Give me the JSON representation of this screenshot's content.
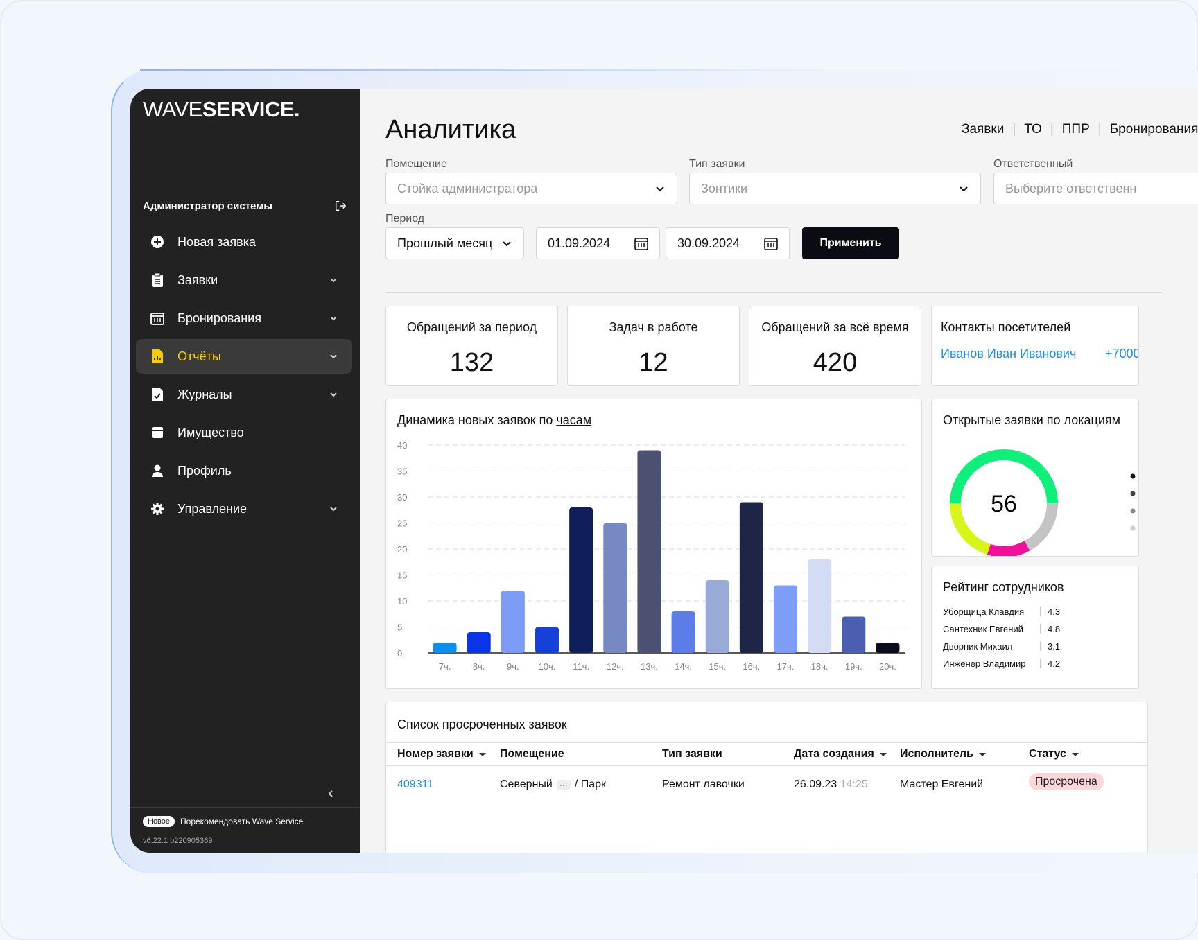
{
  "brand": {
    "logo_thin": "WAVE",
    "logo_bold": "SERVICE."
  },
  "sidebar": {
    "user_name": "Администратор системы",
    "items": [
      {
        "label": "Новая заявка",
        "icon": "plus-circle-icon",
        "has_chevron": false,
        "active": false
      },
      {
        "label": "Заявки",
        "icon": "clipboard-icon",
        "has_chevron": true,
        "active": false
      },
      {
        "label": "Бронирования",
        "icon": "calendar-icon",
        "has_chevron": true,
        "active": false
      },
      {
        "label": "Отчёты",
        "icon": "report-icon",
        "has_chevron": true,
        "active": true
      },
      {
        "label": "Журналы",
        "icon": "journal-check-icon",
        "has_chevron": true,
        "active": false
      },
      {
        "label": "Имущество",
        "icon": "archive-icon",
        "has_chevron": false,
        "active": false
      },
      {
        "label": "Профиль",
        "icon": "user-icon",
        "has_chevron": false,
        "active": false
      },
      {
        "label": "Управление",
        "icon": "gear-icon",
        "has_chevron": true,
        "active": false
      }
    ],
    "footer": {
      "badge": "Новое",
      "recommend": "Порекомендовать Wave Service",
      "version": "v6.22.1 b220905369"
    }
  },
  "page": {
    "title": "Аналитика"
  },
  "top_tabs": [
    "Заявки",
    "ТО",
    "ППР",
    "Бронирования"
  ],
  "filters": {
    "room_label": "Помещение",
    "room_placeholder": "Стойка администратора",
    "type_label": "Тип заявки",
    "type_placeholder": "Зонтики",
    "resp_label": "Ответственный",
    "resp_placeholder": "Выберите ответственн",
    "period_label": "Период",
    "period_value": "Прошлый месяц",
    "date_from": "01.09.2024",
    "date_to": "30.09.2024",
    "apply_label": "Применить"
  },
  "stats": [
    {
      "title": "Обращений за период",
      "value": "132"
    },
    {
      "title": "Задач в работе",
      "value": "12"
    },
    {
      "title": "Обращений за всё время",
      "value": "420"
    }
  ],
  "contacts": {
    "title": "Контакты посетителей",
    "name": "Иванов Иван Иванович",
    "phone": "+7000"
  },
  "chart_data": {
    "type": "bar",
    "title_prefix": "Динамика новых заявок по ",
    "title_link": "часам",
    "categories": [
      "7ч.",
      "8ч.",
      "9ч.",
      "10ч.",
      "11ч.",
      "12ч.",
      "13ч.",
      "14ч.",
      "15ч.",
      "16ч.",
      "17ч.",
      "18ч.",
      "19ч.",
      "20ч."
    ],
    "values": [
      2,
      4,
      12,
      5,
      28,
      25,
      39,
      8,
      14,
      29,
      13,
      18,
      7,
      2
    ],
    "colors": [
      "#0a8ef0",
      "#0a34e8",
      "#7c9cf5",
      "#1541d8",
      "#0e1f5c",
      "#7689c2",
      "#4b5170",
      "#5c7de8",
      "#9aaad6",
      "#1e2547",
      "#7e9df7",
      "#d3dbf5",
      "#4a5fb0",
      "#080c1c"
    ],
    "ylim": [
      0,
      40
    ],
    "yticks": [
      0,
      5,
      10,
      15,
      20,
      25,
      30,
      35,
      40
    ],
    "grid": true
  },
  "donut": {
    "title": "Открытые заявки по локациям",
    "total": "56",
    "segments": [
      {
        "value": 0.5,
        "color": "#0ff07a"
      },
      {
        "value": 0.17,
        "color": "#c4c4c4"
      },
      {
        "value": 0.13,
        "color": "#f0109a"
      },
      {
        "value": 0.2,
        "color": "#d8f51a"
      }
    ],
    "legend_colors": [
      "#111111",
      "#444444",
      "#888888",
      "#cccccc"
    ]
  },
  "rating": {
    "title": "Рейтинг сотрудников",
    "rows": [
      {
        "name": "Уборщица Клавдия",
        "score": "4.3"
      },
      {
        "name": "Сантехник Евгений",
        "score": "4.8"
      },
      {
        "name": "Дворник Михаил",
        "score": "3.1"
      },
      {
        "name": "Инженер Владимир",
        "score": "4.2"
      }
    ]
  },
  "overdue": {
    "title": "Список просроченных заявок",
    "headers": [
      "Номер заявки",
      "Помещение",
      "Тип заявки",
      "Дата создания",
      "Исполнитель",
      "Статус"
    ],
    "row": {
      "number": "409311",
      "room_a": "Северный",
      "room_dots": "···",
      "room_b": "/ Парк",
      "type": "Ремонт лавочки",
      "date": "26.09.23",
      "time": "14:25",
      "executor": "Мастер Евгений",
      "status": "Просрочена"
    }
  }
}
